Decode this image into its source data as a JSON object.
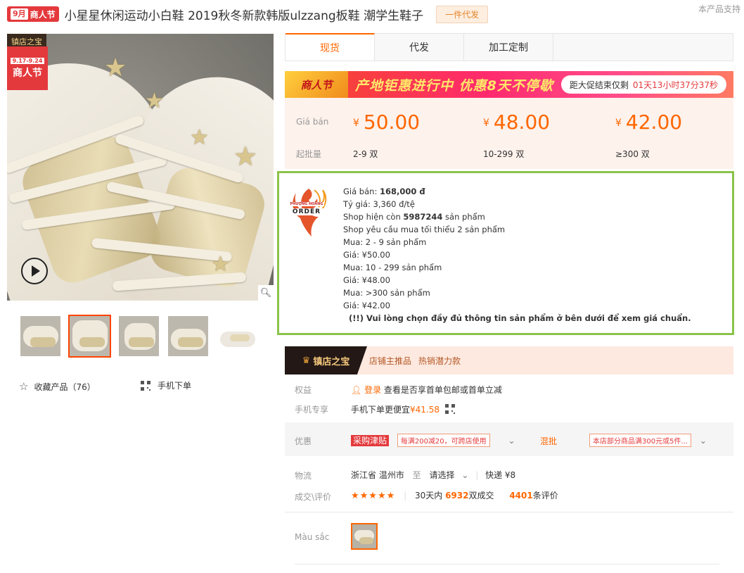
{
  "header": {
    "festival_month": "9月",
    "festival_name": "商人节",
    "title": "小星星休闲运动小白鞋 2019秋冬新款韩版ulzzang板鞋 潮学生鞋子",
    "dropship_tag": "一件代发",
    "support_text": "本产品支持"
  },
  "gallery": {
    "store_label": "镇店之宝",
    "festival_corner_date": "9.17-9.24",
    "festival_corner_text": "商人节",
    "thumbnails_count": 5,
    "active_thumbnail": 2,
    "favorite_label": "收藏产品（76）",
    "mobile_order_label": "手机下单"
  },
  "tabs": [
    {
      "label": "现货",
      "active": true
    },
    {
      "label": "代发",
      "active": false
    },
    {
      "label": "加工定制",
      "active": false
    }
  ],
  "promo": {
    "logo_text": "商人节",
    "banner_text": "产地钜惠进行中 优惠8天不停歇",
    "countdown_label": "距大促结束仅剩",
    "countdown_value": "01天13小时37分37秒"
  },
  "pricing": {
    "price_label": "Giá bán",
    "qty_label": "起批量",
    "currency": "¥",
    "tiers": [
      {
        "price": "50.00",
        "qty": "2-9 双"
      },
      {
        "price": "48.00",
        "qty": "10-299 双"
      },
      {
        "price": "42.00",
        "qty": "≥300 双"
      }
    ]
  },
  "order_box": {
    "logo_line1": "PHƯỢNG HOÀNG",
    "logo_line2": "ORDER",
    "sale_price_label": "Giá bán: ",
    "sale_price": "168,000 đ",
    "exchange_rate": "Tỷ giá: 3,360 đ/tệ",
    "stock_prefix": "Shop hiện còn ",
    "stock": "5987244",
    "stock_suffix": " sản phẩm",
    "min_order": "Shop yêu cầu mua tối thiểu 2 sản phẩm",
    "tier_lines": [
      "Mua: 2 - 9 sản phẩm",
      "Giá: ¥50.00",
      "Mua: 10 - 299 sản phẩm",
      "Giá: ¥48.00",
      "Mua: >300 sản phẩm",
      "Giá: ¥42.00"
    ],
    "note": "(!!) Vui lòng chọn đầy đủ thông tin sản phẩm ở bên dưới để xem giá chuẩn."
  },
  "store_bar": {
    "treasure_label": "镇店之宝",
    "sub1": "店铺主推品",
    "sub2": "热销潜力款"
  },
  "info": {
    "rights_label": "权益",
    "login_link": "登录",
    "rights_text": "查看是否享首单包邮或首单立减",
    "mobile_label": "手机专享",
    "mobile_text": "手机下单更便宜",
    "mobile_price": "¥41.58",
    "discount_label": "优惠",
    "discount_tag": "采购津贴",
    "coupon1": "每满200减20，可跨店使用",
    "mixed_label": "混批",
    "coupon2": "本店部分商品满300元或5件...",
    "logistics_label": "物流",
    "origin": "浙江省 温州市",
    "to": "至",
    "destination": "请选择",
    "shipping": "快递 ¥8",
    "deals_label": "成交\\评价",
    "stars": "★★★★★",
    "deals_prefix": "30天内 ",
    "deals_count": "6932",
    "deals_suffix": "双成交",
    "reviews_count": "4401",
    "reviews_suffix": "条评价",
    "color_label": "Màu sắc"
  }
}
